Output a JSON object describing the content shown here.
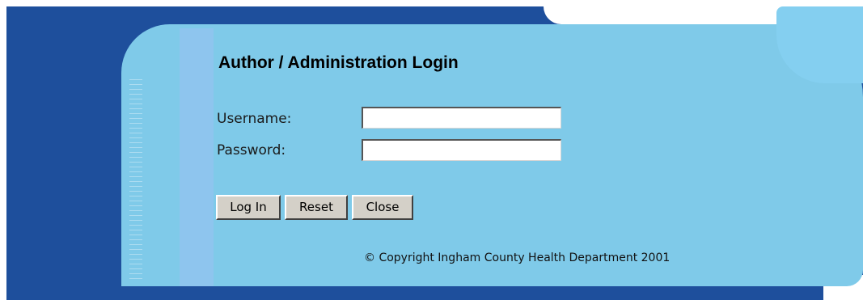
{
  "login": {
    "title": "Author / Administration Login",
    "username_label": "Username:",
    "password_label": "Password:",
    "username_value": "",
    "password_value": "",
    "buttons": {
      "login": "Log In",
      "reset": "Reset",
      "close": "Close"
    }
  },
  "footer": {
    "copyright": "© Copyright Ingham County Health Department 2001"
  },
  "colors": {
    "frame": "#1e4f9c",
    "panel": "#7fcae9",
    "button_face": "#d4d0c8"
  }
}
